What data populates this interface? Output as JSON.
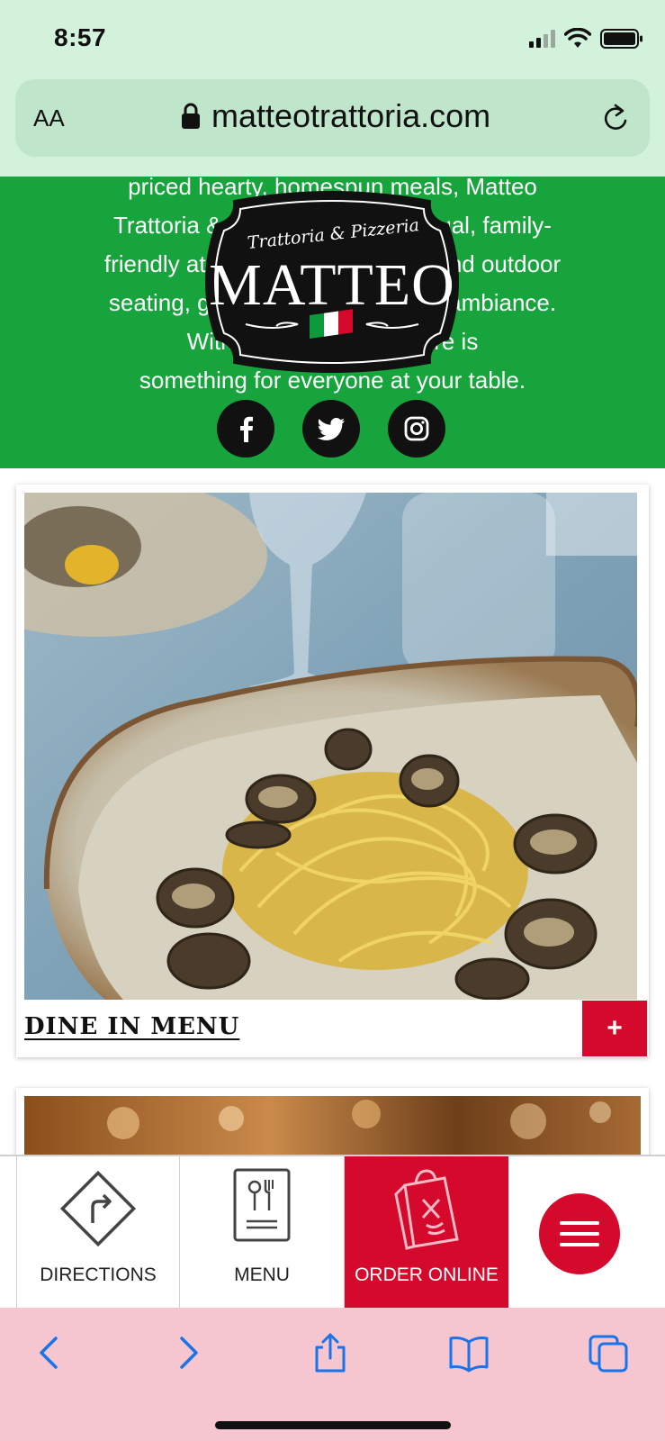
{
  "status_bar": {
    "time": "8:57"
  },
  "browser": {
    "text_size_label": "AA",
    "url": "matteotrattoria.com"
  },
  "hero": {
    "lines": [
      "priced hearty, homespun meals, Matteo",
      "Trattoria & Pizzeria offers a casual, family-",
      "friendly atmosphere with indoor and outdoor",
      "seating, guaranteeing a relaxing ambiance.",
      "With a varied menu, there is",
      "something for everyone at your table."
    ],
    "logo": {
      "script_text": "Trattoria & Pizzeria",
      "name": "MATTEO"
    },
    "social": [
      "facebook-icon",
      "twitter-icon",
      "instagram-icon"
    ]
  },
  "menu_card": {
    "title": "DINE IN MENU",
    "expand_label": "+"
  },
  "bottom_nav": {
    "items": [
      {
        "label": "DIRECTIONS",
        "icon": "directions-sign-icon"
      },
      {
        "label": "MENU",
        "icon": "menu-fork-knife-icon"
      },
      {
        "label": "ORDER ONLINE",
        "icon": "takeout-bag-icon"
      }
    ],
    "hamburger_icon": "hamburger-menu-icon"
  },
  "colors": {
    "accent_red": "#d4092c",
    "hero_green": "#17a43c",
    "toolbar_pink": "#f6c6d0",
    "url_bar_green": "#bfe5cb",
    "ios_blue": "#1a73e8"
  }
}
